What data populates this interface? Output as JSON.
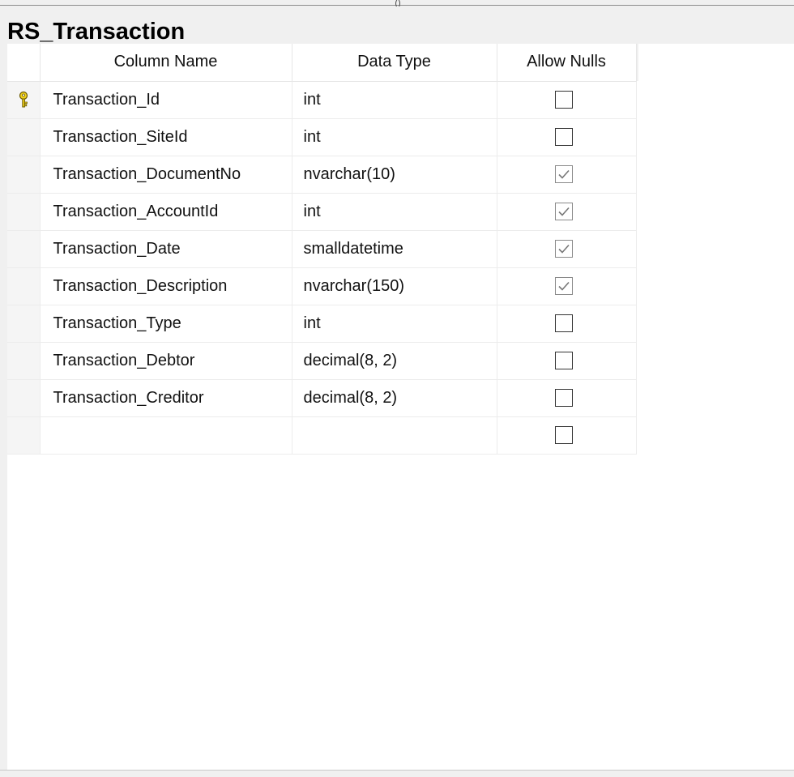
{
  "top_mark": "()",
  "table": {
    "title": "RS_Transaction",
    "headers": {
      "column_name": "Column Name",
      "data_type": "Data Type",
      "allow_nulls": "Allow Nulls"
    },
    "rows": [
      {
        "name": "Transaction_Id",
        "type": "int",
        "allow_nulls": false,
        "primary_key": true
      },
      {
        "name": "Transaction_SiteId",
        "type": "int",
        "allow_nulls": false,
        "primary_key": false
      },
      {
        "name": "Transaction_DocumentNo",
        "type": "nvarchar(10)",
        "allow_nulls": true,
        "primary_key": false
      },
      {
        "name": "Transaction_AccountId",
        "type": "int",
        "allow_nulls": true,
        "primary_key": false
      },
      {
        "name": "Transaction_Date",
        "type": "smalldatetime",
        "allow_nulls": true,
        "primary_key": false
      },
      {
        "name": "Transaction_Description",
        "type": "nvarchar(150)",
        "allow_nulls": true,
        "primary_key": false
      },
      {
        "name": "Transaction_Type",
        "type": "int",
        "allow_nulls": false,
        "primary_key": false
      },
      {
        "name": "Transaction_Debtor",
        "type": "decimal(8, 2)",
        "allow_nulls": false,
        "primary_key": false
      },
      {
        "name": "Transaction_Creditor",
        "type": "decimal(8, 2)",
        "allow_nulls": false,
        "primary_key": false
      },
      {
        "name": "",
        "type": "",
        "allow_nulls": false,
        "primary_key": false
      }
    ]
  },
  "icons": {
    "primary_key": "key-icon",
    "checked": "checkmark-icon"
  },
  "colors": {
    "key_yellow": "#f2d21b",
    "checkbox_border": "#333333",
    "checked_border": "#8a8a8a",
    "check_mark": "#777777"
  }
}
